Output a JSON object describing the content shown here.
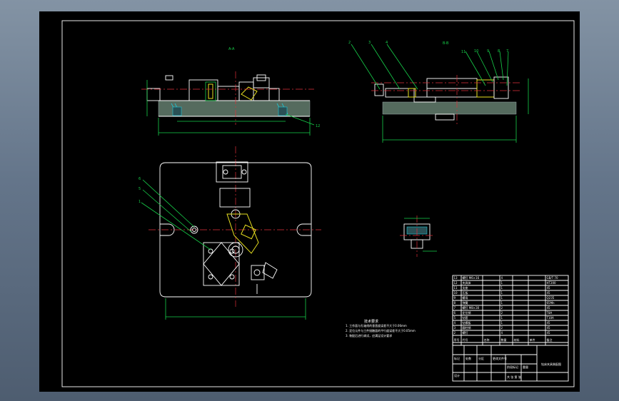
{
  "drawing": {
    "section_a_label": "A-A",
    "section_b_label": "B-B",
    "balloons_top_right": [
      "2",
      "3",
      "4",
      "11",
      "10",
      "9",
      "8",
      "7"
    ],
    "balloons_left": [
      "6",
      "5",
      "1"
    ],
    "balloon_front": "12",
    "tech_title": "技术要求",
    "tech_items": [
      "1. 工作面与孔轴线的垂直度误差不大于0.06mm",
      "2. 定位元件与工件接触面的平行度误差不大于0.05mm",
      "3. 装配后进行调试，应满足设计要求"
    ],
    "bom_rows": [
      [
        "13",
        "螺钉 M6×16",
        "",
        "4",
        "",
        "",
        "GB/T 70"
      ],
      [
        "12",
        "夹具体",
        "",
        "1",
        "",
        "",
        "HT200"
      ],
      [
        "11",
        "支座",
        "",
        "1",
        "",
        "",
        "45"
      ],
      [
        "10",
        "压板",
        "",
        "1",
        "",
        "",
        "45"
      ],
      [
        "9",
        "螺母",
        "",
        "1",
        "",
        "",
        "Q235"
      ],
      [
        "8",
        "弹簧",
        "",
        "1",
        "",
        "",
        "65Mn"
      ],
      [
        "7",
        "螺钉 M8×30",
        "",
        "2",
        "",
        "",
        "45"
      ],
      [
        "6",
        "定位销",
        "",
        "2",
        "",
        "",
        "T8A"
      ],
      [
        "5",
        "钻套",
        "",
        "1",
        "",
        "",
        "T10A"
      ],
      [
        "4",
        "钻模板",
        "",
        "1",
        "",
        "",
        "45"
      ],
      [
        "3",
        "圆柱销",
        "",
        "2",
        "",
        "",
        "45"
      ],
      [
        "2",
        "螺钉",
        "",
        "4",
        "",
        "",
        "45"
      ]
    ],
    "bom_header": [
      "序号",
      "代号",
      "名称",
      "数量",
      "材料",
      "单件",
      "备注"
    ],
    "title_block_name": "钻床夹具装配图",
    "title_block_labels": [
      "标记",
      "处数",
      "分区",
      "更改文件号",
      "签名",
      "年月日",
      "设计",
      "审核",
      "工艺",
      "批准",
      "阶段标记",
      "重量",
      "比例",
      "共 张 第 张"
    ]
  }
}
